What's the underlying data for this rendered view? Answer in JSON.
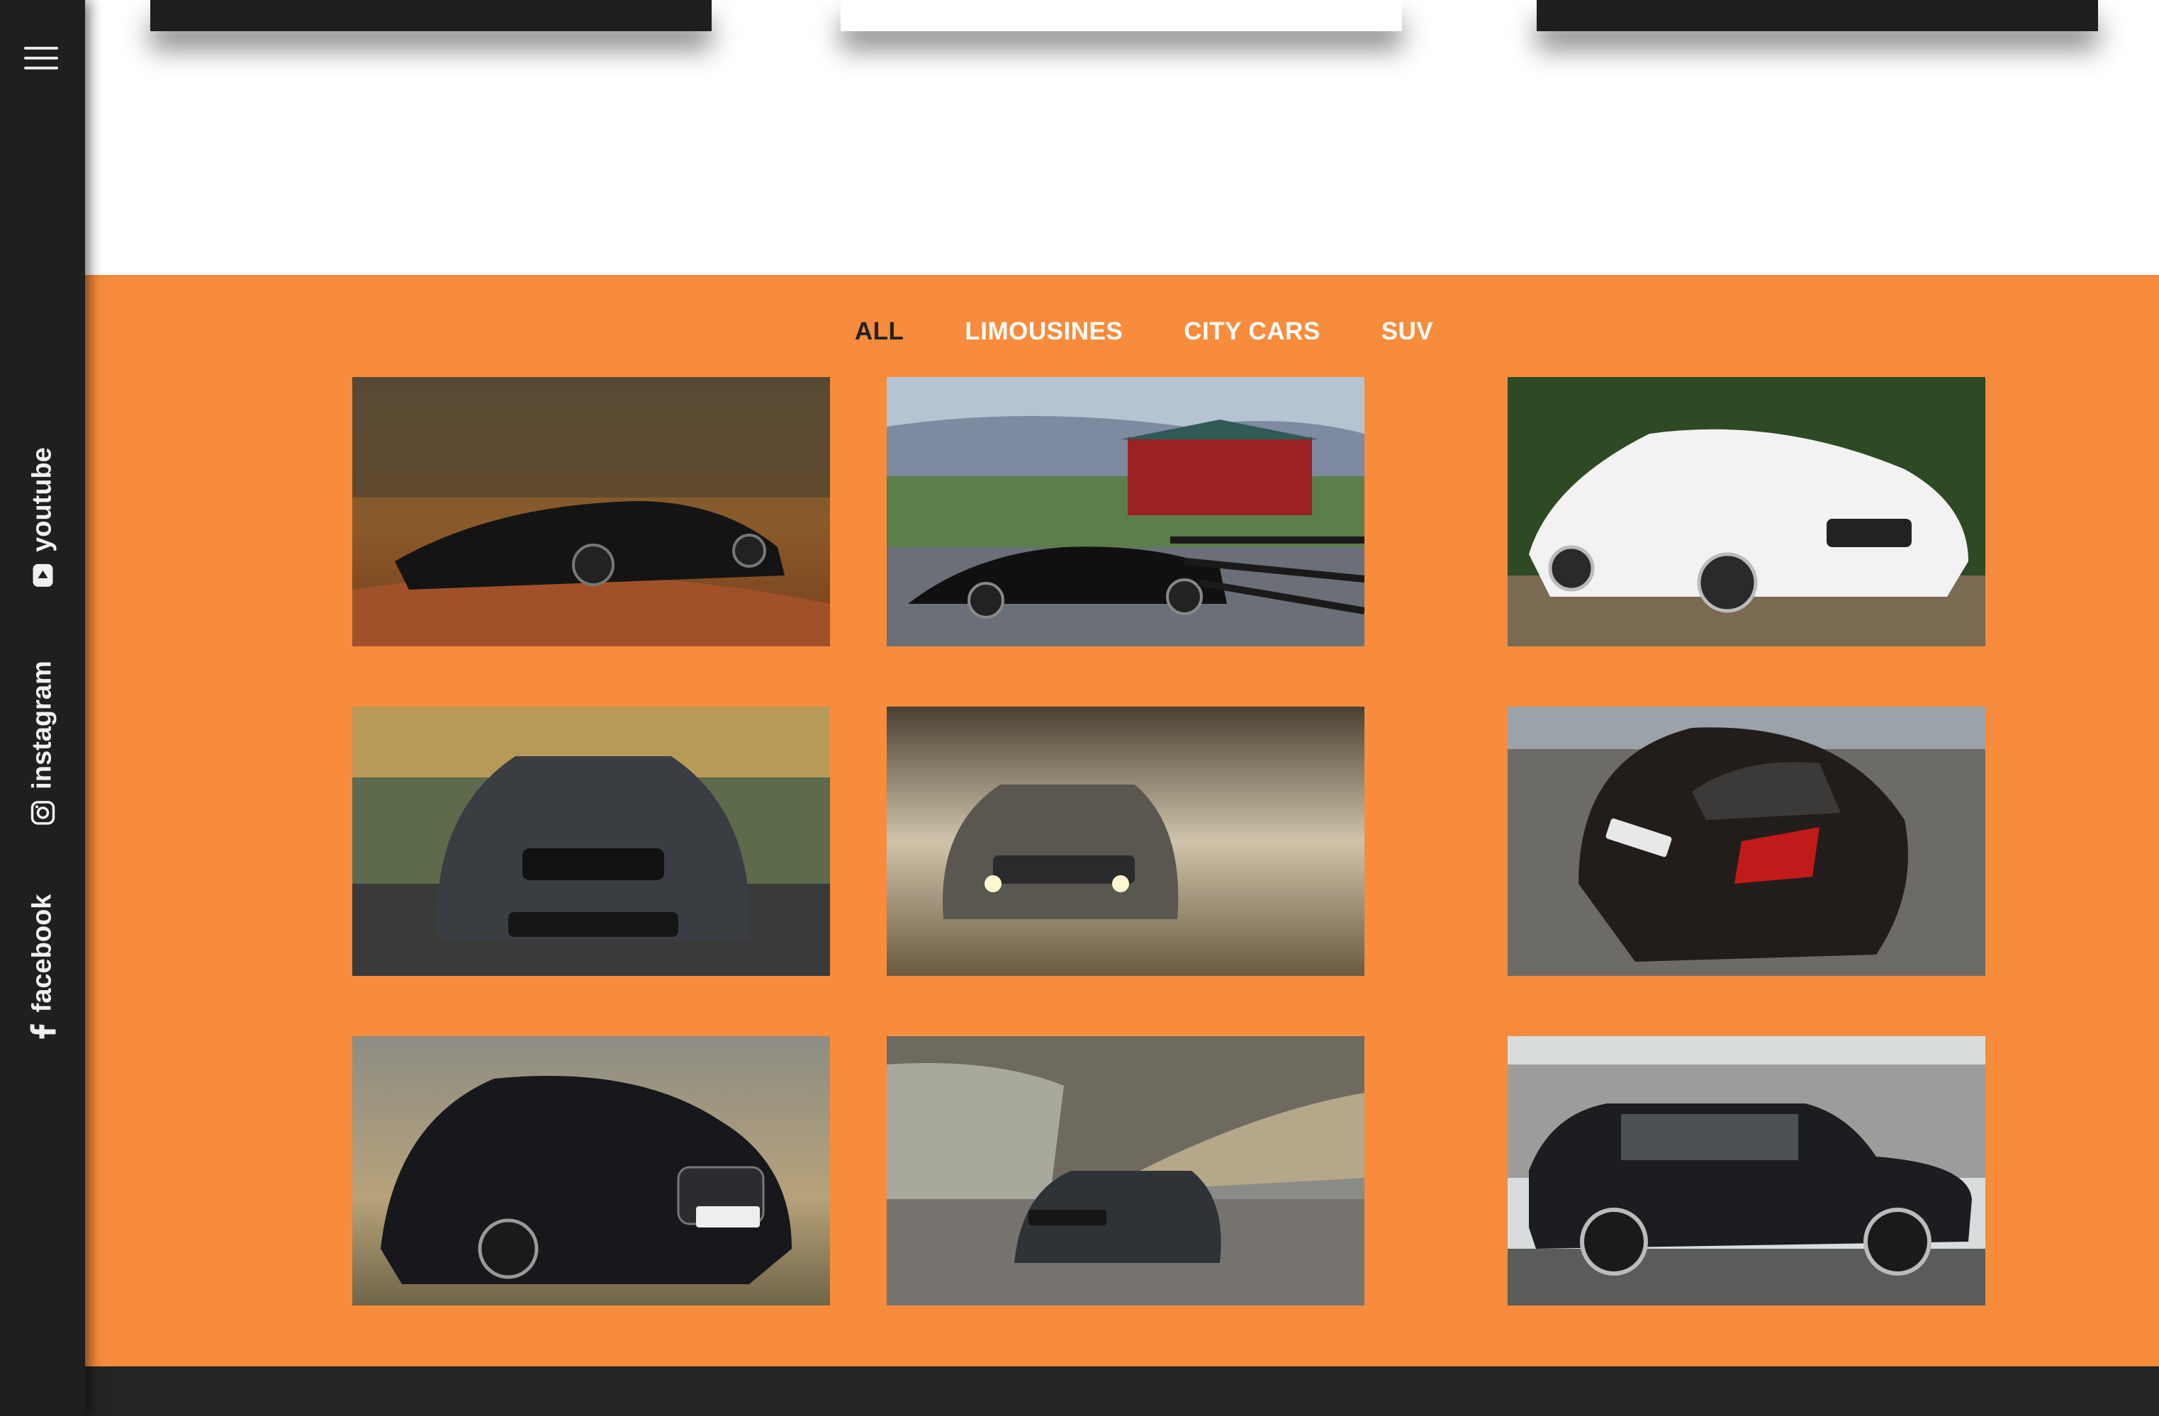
{
  "sidebar": {
    "menu_icon": "hamburger-menu-icon",
    "social_links": [
      {
        "label": "youtube",
        "icon": "youtube-icon"
      },
      {
        "label": "instagram",
        "icon": "instagram-icon"
      },
      {
        "label": "facebook",
        "icon": "facebook-icon"
      }
    ]
  },
  "gallery": {
    "background": "#f68c3c",
    "filters": [
      {
        "label": "ALL",
        "active": true
      },
      {
        "label": "LIMOUSINES",
        "active": false
      },
      {
        "label": "CITY CARS",
        "active": false
      },
      {
        "label": "SUV",
        "active": false
      }
    ],
    "photos": [
      {
        "subject": "black sedan in autumn forest"
      },
      {
        "subject": "black sedan by red barn"
      },
      {
        "subject": "white sedan front view"
      },
      {
        "subject": "dark grey sports sedan front view"
      },
      {
        "subject": "silver suv in misty field"
      },
      {
        "subject": "black hatchback rear view"
      },
      {
        "subject": "black hatchback front view"
      },
      {
        "subject": "dark suv in mountain valley"
      },
      {
        "subject": "black suv side view in snow"
      }
    ]
  },
  "colors": {
    "sidebar": "#1f1f1f",
    "accent": "#f68c3c",
    "footer": "#242424"
  }
}
